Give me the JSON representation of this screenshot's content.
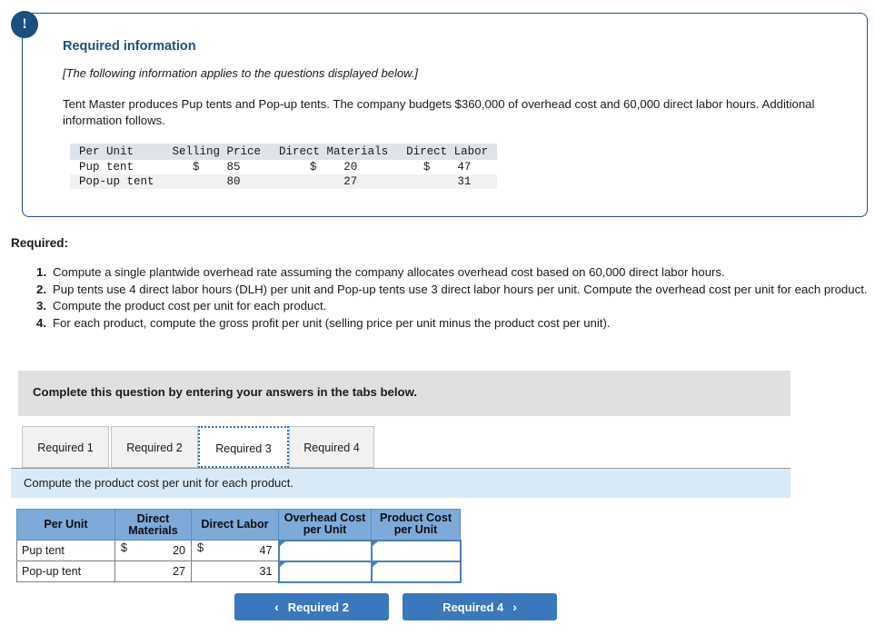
{
  "info_panel": {
    "badge_icon": "exclamation-icon",
    "badge_text": "!",
    "heading": "Required information",
    "italic_note": "[The following information applies to the questions displayed below.]",
    "paragraph": "Tent Master produces Pup tents and Pop-up tents. The company budgets $360,000 of overhead cost and 60,000 direct labor hours. Additional information follows.",
    "data_table": {
      "headers": [
        "Per Unit",
        "Selling Price",
        "Direct Materials",
        "Direct Labor"
      ],
      "rows": [
        {
          "label": "Pup tent",
          "selling_price_currency": "$",
          "selling_price": "85",
          "direct_materials_currency": "$",
          "direct_materials": "20",
          "direct_labor_currency": "$",
          "direct_labor": "47"
        },
        {
          "label": "Pop-up tent",
          "selling_price_currency": "",
          "selling_price": "80",
          "direct_materials_currency": "",
          "direct_materials": "27",
          "direct_labor_currency": "",
          "direct_labor": "31"
        }
      ]
    }
  },
  "required": {
    "label": "Required:",
    "items": [
      {
        "num": "1.",
        "text": "Compute a single plantwide overhead rate assuming the company allocates overhead cost based on 60,000 direct labor hours."
      },
      {
        "num": "2.",
        "text": "Pup tents use 4 direct labor hours (DLH) per unit and Pop-up tents use 3 direct labor hours per unit. Compute the overhead cost per unit for each product."
      },
      {
        "num": "3.",
        "text": "Compute the product cost per unit for each product."
      },
      {
        "num": "4.",
        "text": "For each product, compute the gross profit per unit (selling price per unit minus the product cost per unit)."
      }
    ]
  },
  "complete_bar": {
    "text": "Complete this question by entering your answers in the tabs below."
  },
  "tabs": {
    "items": [
      {
        "label": "Required 1",
        "active": false
      },
      {
        "label": "Required 2",
        "active": false
      },
      {
        "label": "Required 3",
        "active": true
      },
      {
        "label": "Required 4",
        "active": false
      }
    ]
  },
  "question_strip": {
    "text": "Compute the product cost per unit for each product."
  },
  "answer_table": {
    "headers": [
      "Per Unit",
      "Direct Materials",
      "Direct Labor",
      "Overhead Cost per Unit",
      "Product Cost per Unit"
    ],
    "header_lines": {
      "per_unit": "Per Unit",
      "direct_materials_l1": "Direct",
      "direct_materials_l2": "Materials",
      "direct_labor": "Direct Labor",
      "overhead_l1": "Overhead Cost",
      "overhead_l2": "per Unit",
      "product_l1": "Product Cost",
      "product_l2": "per Unit"
    },
    "rows": [
      {
        "label": "Pup tent",
        "dm_currency": "$",
        "dm_value": "20",
        "dl_currency": "$",
        "dl_value": "47",
        "overhead_value": "",
        "product_value": ""
      },
      {
        "label": "Pop-up tent",
        "dm_currency": "",
        "dm_value": "27",
        "dl_currency": "",
        "dl_value": "31",
        "overhead_value": "",
        "product_value": ""
      }
    ]
  },
  "nav": {
    "prev_label": "Required 2",
    "prev_chevron": "‹",
    "next_label": "Required 4",
    "next_chevron": "›"
  },
  "colors": {
    "panel_border": "#1f5087",
    "badge": "#1c4e80",
    "heading": "#1c4e80",
    "gray_bar": "#e0e0e0",
    "question_strip": "#d8eaf8",
    "table_header": "#7eaada",
    "input_border": "#4a7fba",
    "button": "#3b77bd",
    "mono_header": "#dfe3ec",
    "mono_alt_row": "#f1f1f1"
  }
}
